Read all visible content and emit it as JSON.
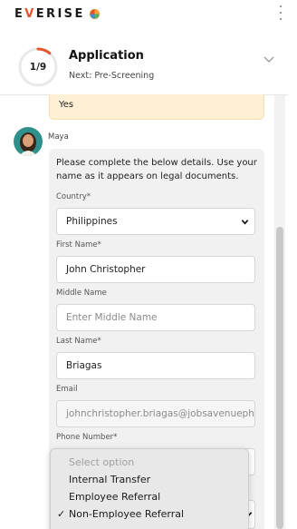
{
  "brand": {
    "name_prefix": "E",
    "name_mark": "V",
    "name_suffix": "ERISE"
  },
  "progress": {
    "step_label": "1/9",
    "fraction": 0.111,
    "title": "Application",
    "subtitle": "Next: Pre-Screening"
  },
  "chat": {
    "previous_answer": "Yes",
    "bot_name": "Maya",
    "intro": "Please complete the below details. Use your name as it appears on legal documents."
  },
  "form": {
    "country_label": "Country*",
    "country_value": "Philippines",
    "first_name_label": "First Name*",
    "first_name_value": "John Christopher",
    "middle_name_label": "Middle Name",
    "middle_name_placeholder": "Enter Middle Name",
    "last_name_label": "Last Name*",
    "last_name_value": "Briagas",
    "email_label": "Email",
    "email_value": "johnchristopher.briagas@jobsavenueph",
    "phone_label": "Phone Number*"
  },
  "dropdown": {
    "placeholder": "Select option",
    "options": [
      "Internal Transfer",
      "Employee Referral",
      "Non-Employee Referral"
    ],
    "selected": "Non-Employee Referral"
  },
  "colors": {
    "accent": "#e5532b",
    "ring_track": "#e9e9e9",
    "answer_bg": "#fdf0d5",
    "bubble_bg": "#f1f1f1"
  }
}
